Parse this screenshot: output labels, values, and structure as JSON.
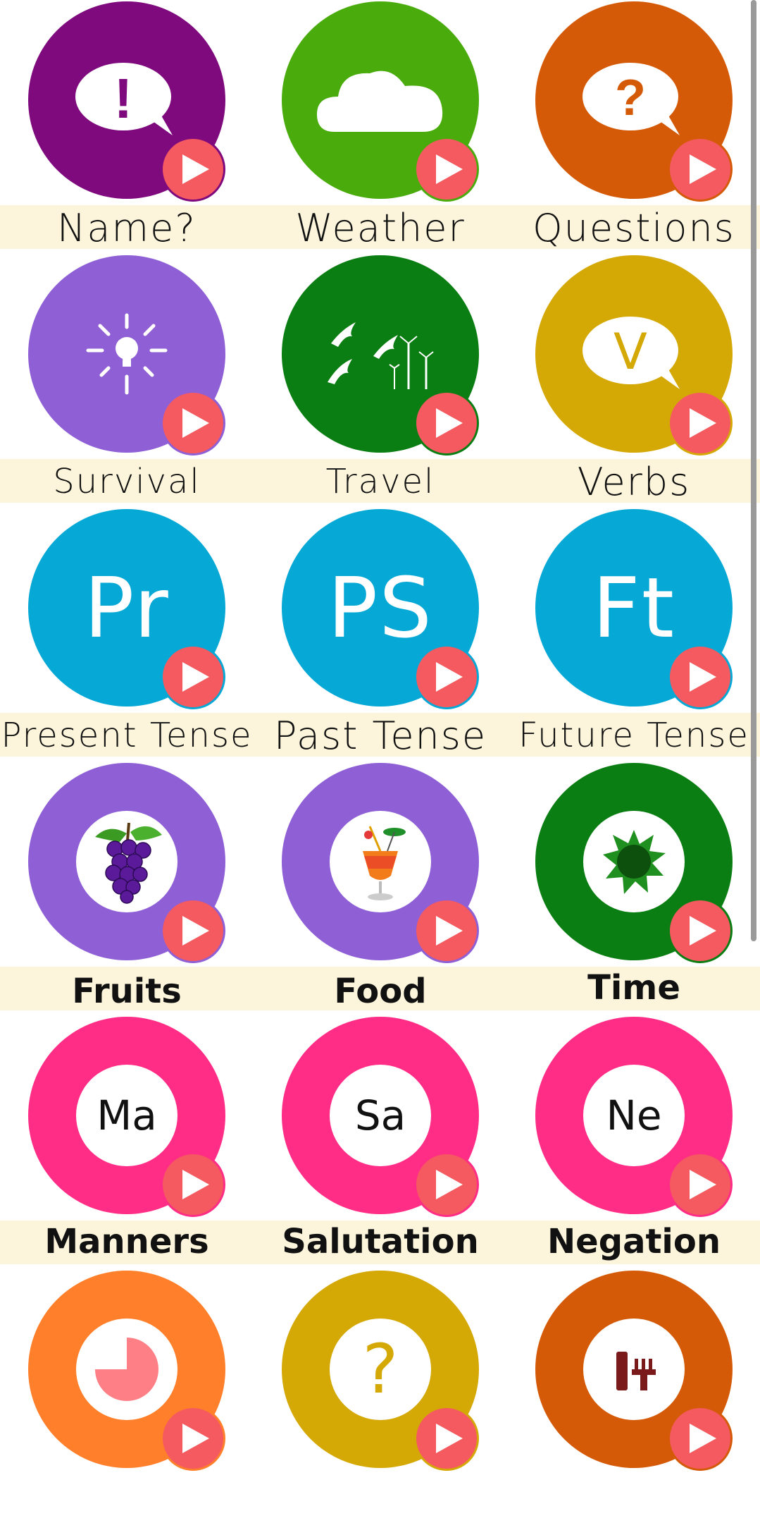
{
  "app": {
    "accent": "#f45a5f",
    "band_color": "#fcf5db"
  },
  "tiles": [
    {
      "label": "Name?",
      "color": "#7e0a7e",
      "icon": "exclamation-speech-bubble-icon",
      "glyph": "!"
    },
    {
      "label": "Weather",
      "color": "#4aab0c",
      "icon": "cloud-icon"
    },
    {
      "label": "Questions",
      "color": "#d45a08",
      "icon": "question-speech-bubble-icon",
      "glyph": "?"
    },
    {
      "label": "Survival",
      "color": "#8f5fd6",
      "icon": "lightbulb-icon"
    },
    {
      "label": "Travel",
      "color": "#0a7e12",
      "icon": "birds-windmills-icon"
    },
    {
      "label": "Verbs",
      "color": "#d4a805",
      "icon": "v-speech-bubble-icon",
      "glyph": "V"
    },
    {
      "label": "Present Tense",
      "color": "#06a8d6",
      "icon": "present-tense-icon",
      "abbr": "Pr"
    },
    {
      "label": "Past Tense",
      "color": "#06a8d6",
      "icon": "past-tense-icon",
      "abbr": "PS"
    },
    {
      "label": "Future Tense",
      "color": "#06a8d6",
      "icon": "future-tense-icon",
      "abbr": "Ft"
    },
    {
      "label": "Fruits",
      "color": "#8f5fd6",
      "icon": "grapes-icon"
    },
    {
      "label": "Food",
      "color": "#8f5fd6",
      "icon": "cocktail-icon"
    },
    {
      "label": "Time",
      "color": "#0a7e12",
      "icon": "sun-icon"
    },
    {
      "label": "Manners",
      "color": "#ff2d86",
      "icon": "manners-icon",
      "abbr": "Ma"
    },
    {
      "label": "Salutation",
      "color": "#ff2d86",
      "icon": "salutation-icon",
      "abbr": "Sa"
    },
    {
      "label": "Negation",
      "color": "#ff2d86",
      "icon": "negation-icon",
      "abbr": "Ne"
    },
    {
      "label": "",
      "color": "#ff7f2a",
      "icon": "pie-clock-icon"
    },
    {
      "label": "",
      "color": "#d4a805",
      "icon": "question-mark-icon",
      "glyph": "?"
    },
    {
      "label": "",
      "color": "#d45a08",
      "icon": "fork-knife-icon"
    }
  ]
}
